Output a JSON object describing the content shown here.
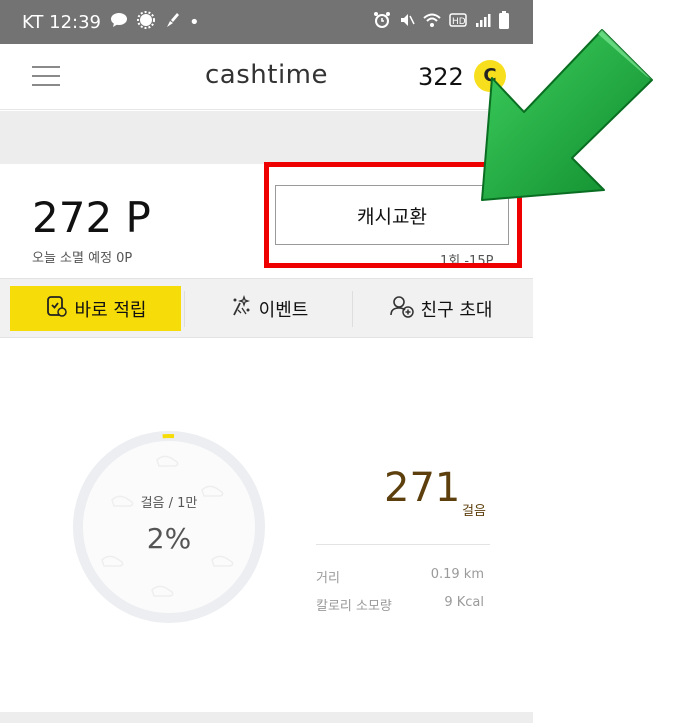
{
  "status_bar": {
    "carrier_time": "KT 12:39",
    "dot": "•"
  },
  "header": {
    "logo": "cashtime",
    "coin_count": "322",
    "coin_symbol": "C"
  },
  "points": {
    "value": "272 P",
    "expire_note": "오늘 소멸 예정 0P"
  },
  "cash_exchange": {
    "label": "캐시교환",
    "note": "1회 -15P"
  },
  "tabs": [
    {
      "label": "바로 적립",
      "icon": "wallet-check-icon",
      "active": true
    },
    {
      "label": "이벤트",
      "icon": "sparkle-icon",
      "active": false
    },
    {
      "label": "친구 초대",
      "icon": "add-friend-icon",
      "active": false
    }
  ],
  "steps": {
    "goal_label": "걸음 / 1만",
    "percent": "2%",
    "percent_value": 0.02,
    "count": "271",
    "unit": "걸음",
    "distance_label": "거리",
    "distance_value": "0.19 km",
    "calorie_label": "칼로리 소모량",
    "calorie_value": "9 Kcal"
  },
  "colors": {
    "status_bar": "#737373",
    "accent_yellow": "#f6dd0a",
    "highlight_red": "#ee0000",
    "arrow_green": "#17a43a",
    "steps_brown": "#5c3f0c"
  }
}
